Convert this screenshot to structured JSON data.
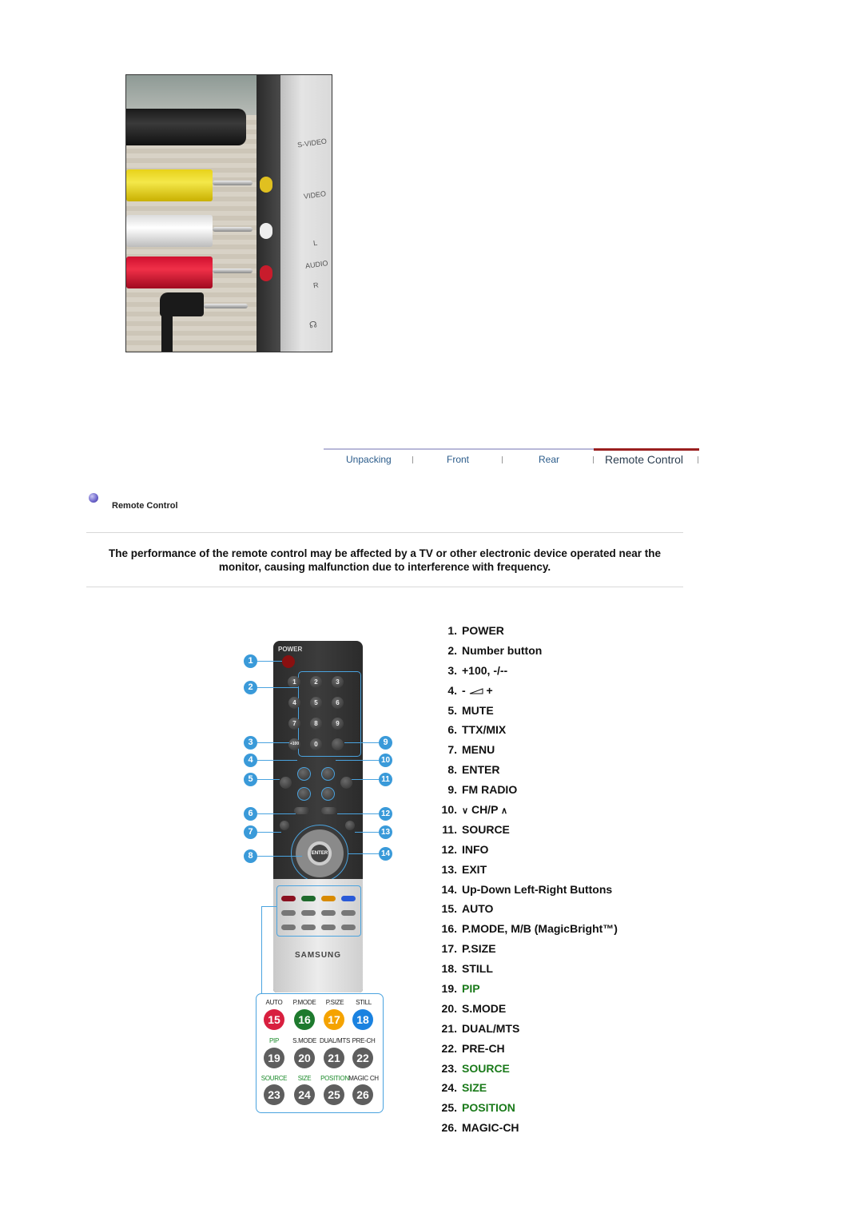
{
  "photo": {
    "panel_labels": [
      "S-VIDEO",
      "VIDEO",
      "L",
      "AUDIO",
      "R"
    ],
    "headphone_icon": "headphone-icon"
  },
  "tabs": [
    {
      "label": "Unpacking",
      "active": false
    },
    {
      "label": "Front",
      "active": false
    },
    {
      "label": "Rear",
      "active": false
    },
    {
      "label": "Remote Control",
      "active": true
    }
  ],
  "section": {
    "title": "Remote Control",
    "bullet_icon": "bullet-sphere-icon",
    "notice": "The performance of the remote control may be affected by a TV or other electronic device operated near the monitor, causing malfunction due to interference with frequency."
  },
  "remote": {
    "power_label": "POWER",
    "number_keys": [
      "1",
      "2",
      "3",
      "4",
      "5",
      "6",
      "7",
      "8",
      "9",
      "0"
    ],
    "enter_label": "ENTER",
    "brand": "SAMSUNG",
    "callouts": [
      "1",
      "2",
      "3",
      "4",
      "5",
      "6",
      "7",
      "8",
      "9",
      "10",
      "11",
      "12",
      "13",
      "14"
    ],
    "legend": [
      {
        "label": "AUTO",
        "num": "15",
        "color": "#d81f3f",
        "label_green": false
      },
      {
        "label": "P.MODE",
        "num": "16",
        "color": "#1e7a2e",
        "label_green": false
      },
      {
        "label": "P.SIZE",
        "num": "17",
        "color": "#f5a300",
        "label_green": false
      },
      {
        "label": "STILL",
        "num": "18",
        "color": "#1a82e0",
        "label_green": false
      },
      {
        "label": "PIP",
        "num": "19",
        "color": "#5e5e5e",
        "label_green": true
      },
      {
        "label": "S.MODE",
        "num": "20",
        "color": "#5e5e5e",
        "label_green": false
      },
      {
        "label": "DUAL/MTS",
        "num": "21",
        "color": "#5e5e5e",
        "label_green": false
      },
      {
        "label": "PRE-CH",
        "num": "22",
        "color": "#5e5e5e",
        "label_green": false
      },
      {
        "label": "SOURCE",
        "num": "23",
        "color": "#5e5e5e",
        "label_green": true
      },
      {
        "label": "SIZE",
        "num": "24",
        "color": "#5e5e5e",
        "label_green": true
      },
      {
        "label": "POSITION",
        "num": "25",
        "color": "#5e5e5e",
        "label_green": true
      },
      {
        "label": "MAGIC CH",
        "num": "26",
        "color": "#5e5e5e",
        "label_green": false
      }
    ]
  },
  "features": [
    {
      "num": "1.",
      "label": "POWER",
      "green": false
    },
    {
      "num": "2.",
      "label": "Number button",
      "green": false
    },
    {
      "num": "3.",
      "label": "+100, -/--",
      "green": false
    },
    {
      "num": "4.",
      "label": "- [volume] +",
      "green": false,
      "prefix": "-",
      "suffix": "+",
      "icon": "volume-ramp-icon"
    },
    {
      "num": "5.",
      "label": "MUTE",
      "green": false
    },
    {
      "num": "6.",
      "label": "TTX/MIX",
      "green": false
    },
    {
      "num": "7.",
      "label": "MENU",
      "green": false
    },
    {
      "num": "8.",
      "label": "ENTER",
      "green": false
    },
    {
      "num": "9.",
      "label": "FM RADIO",
      "green": false
    },
    {
      "num": "10.",
      "label": "CH/P",
      "green": false,
      "prefix_glyph": "⌄",
      "suffix_glyph": "⌃"
    },
    {
      "num": "11.",
      "label": "SOURCE",
      "green": false
    },
    {
      "num": "12.",
      "label": "INFO",
      "green": false
    },
    {
      "num": "13.",
      "label": "EXIT",
      "green": false
    },
    {
      "num": "14.",
      "label": "Up-Down Left-Right Buttons",
      "green": false
    },
    {
      "num": "15.",
      "label": "AUTO",
      "green": false
    },
    {
      "num": "16.",
      "label": "P.MODE, M/B (MagicBright™)",
      "green": false
    },
    {
      "num": "17.",
      "label": "P.SIZE",
      "green": false
    },
    {
      "num": "18.",
      "label": "STILL",
      "green": false
    },
    {
      "num": "19.",
      "label": "PIP",
      "green": true
    },
    {
      "num": "20.",
      "label": "S.MODE",
      "green": false
    },
    {
      "num": "21.",
      "label": "DUAL/MTS",
      "green": false
    },
    {
      "num": "22.",
      "label": "PRE-CH",
      "green": false
    },
    {
      "num": "23.",
      "label": "SOURCE",
      "green": true
    },
    {
      "num": "24.",
      "label": "SIZE",
      "green": true
    },
    {
      "num": "25.",
      "label": "POSITION",
      "green": true
    },
    {
      "num": "26.",
      "label": "MAGIC-CH",
      "green": false
    }
  ]
}
